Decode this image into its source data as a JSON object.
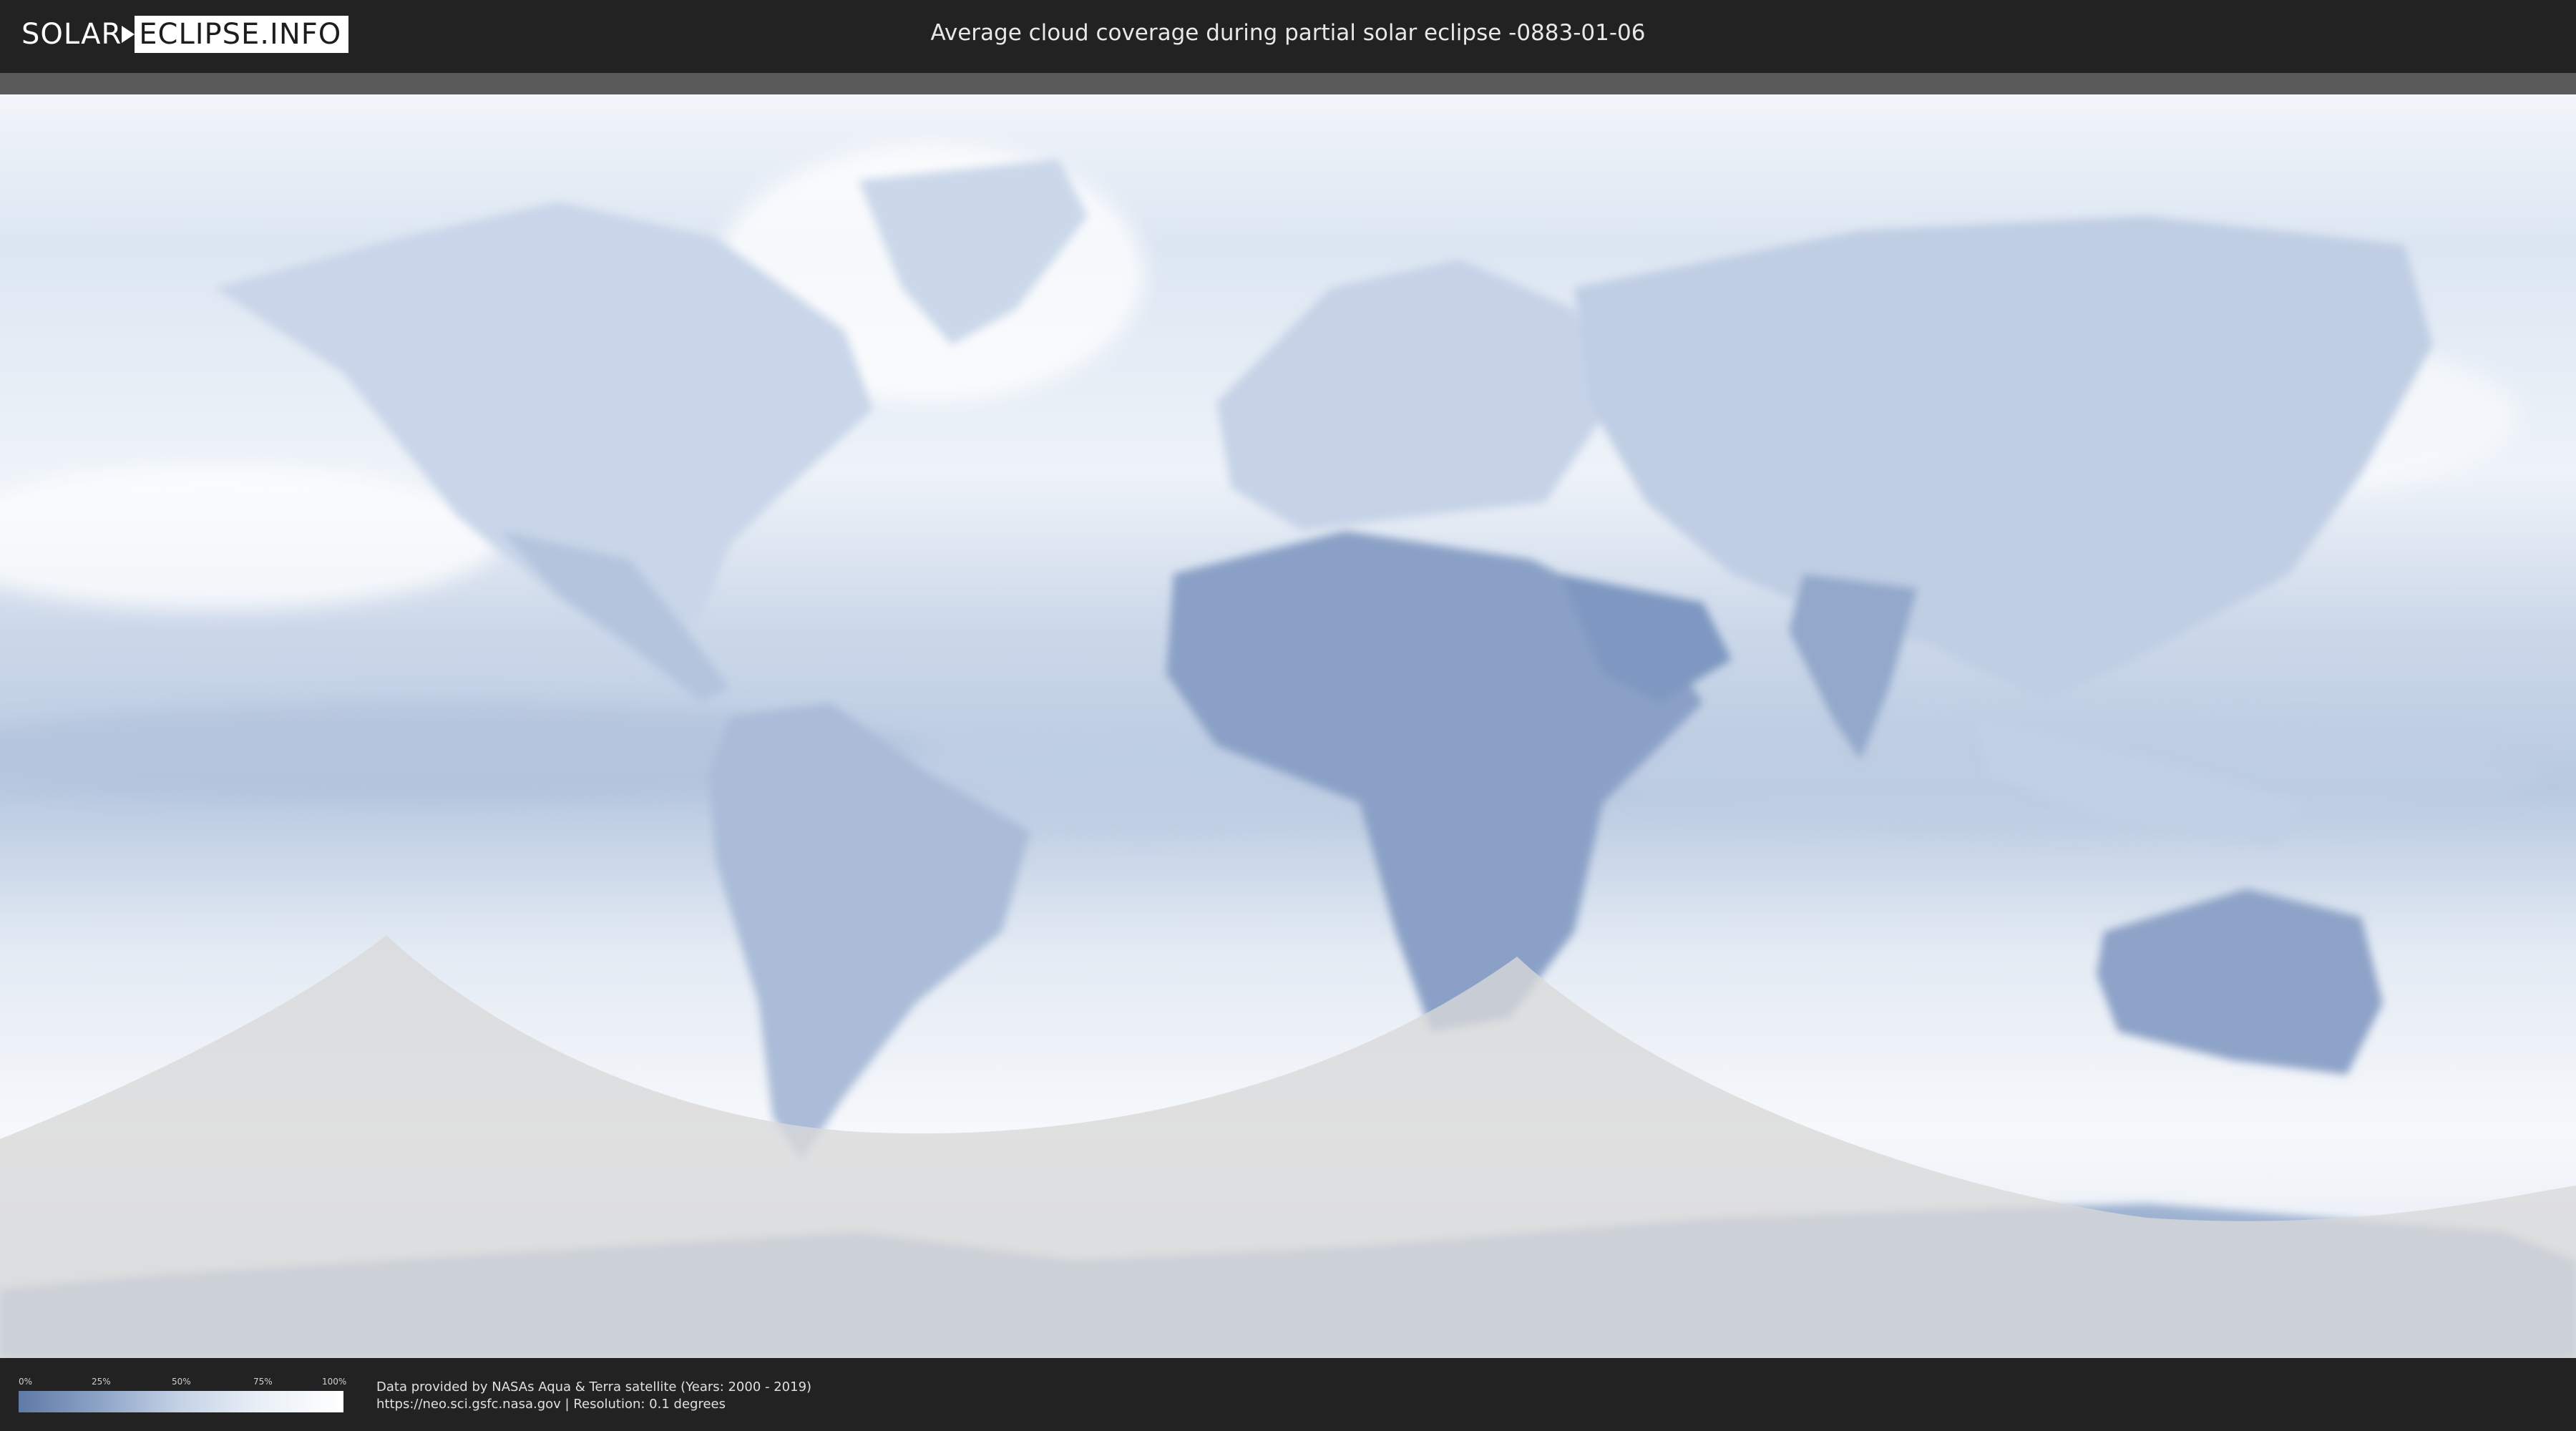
{
  "header": {
    "logo_left": "SOLAR",
    "logo_right": "ECLIPSE.INFO",
    "title": "Average cloud coverage during partial solar eclipse -0883-01-06"
  },
  "legend": {
    "ticks": [
      "0%",
      "25%",
      "50%",
      "75%",
      "100%"
    ],
    "scale_colors": [
      "#5f7aa6",
      "#8da4c7",
      "#c6d3e6",
      "#eaf0f7",
      "#ffffff"
    ]
  },
  "footer": {
    "credit_line1": "Data provided by NASAs Aqua & Terra satellite (Years: 2000 - 2019)",
    "credit_line2": "https://neo.sci.gsfc.nasa.gov | Resolution: 0.1 degrees"
  },
  "map": {
    "projection": "equirectangular",
    "ocean_cloud_color": "#dde6f1",
    "land_clear_color": "#7f98c1",
    "eclipse_shadow_color": "#d9d9d9"
  }
}
